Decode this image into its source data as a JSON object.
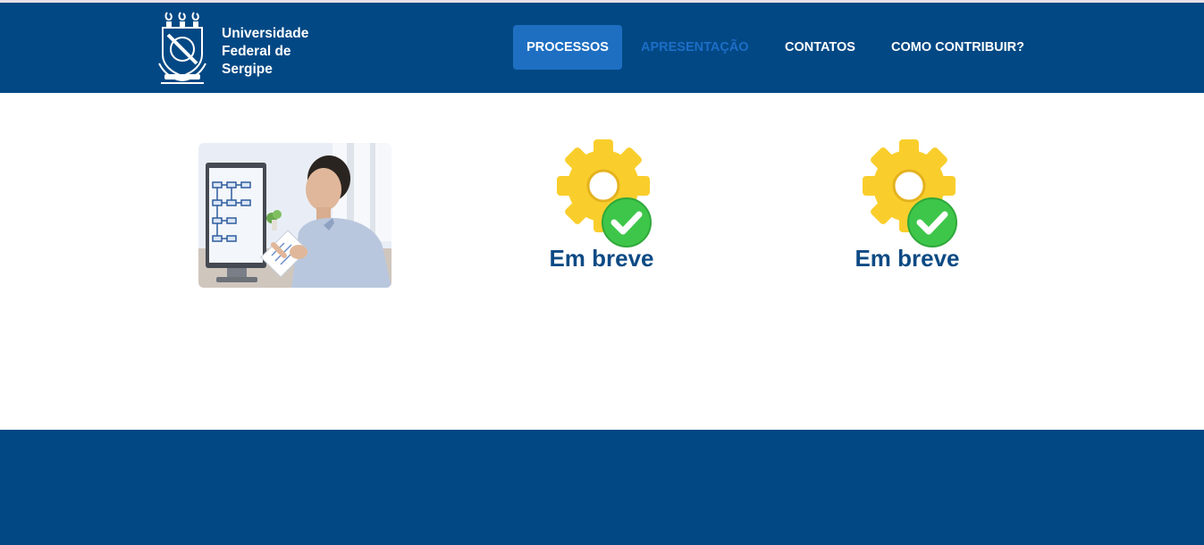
{
  "header": {
    "logo": {
      "line1": "Universidade",
      "line2": "Federal de",
      "line3": "Sergipe"
    },
    "nav": {
      "items": [
        {
          "label": "PROCESSOS",
          "state": "active"
        },
        {
          "label": "APRESENTAÇÃO",
          "state": "muted"
        },
        {
          "label": "CONTATOS",
          "state": "default"
        },
        {
          "label": "COMO CONTRIBUIR?",
          "state": "default"
        }
      ]
    }
  },
  "cards": {
    "card2_label": "Em breve",
    "card3_label": "Em breve"
  },
  "colors": {
    "primary": "#024884",
    "active_nav": "#1e6fc2",
    "heading": "#0d4a84",
    "gear": "#f9ce2c",
    "check": "#3ec64a"
  }
}
